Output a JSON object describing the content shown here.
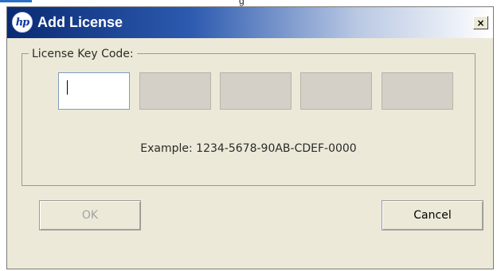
{
  "window": {
    "title": "Add License",
    "logo_text": "hp",
    "close_glyph": "×",
    "behind_fragment": "g"
  },
  "license": {
    "group_label": "License Key Code:",
    "fields": [
      {
        "value": "",
        "placeholder": ""
      },
      {
        "value": "",
        "placeholder": ""
      },
      {
        "value": "",
        "placeholder": ""
      },
      {
        "value": "",
        "placeholder": ""
      },
      {
        "value": "",
        "placeholder": ""
      }
    ],
    "example": "Example: 1234-5678-90AB-CDEF-0000"
  },
  "buttons": {
    "ok_label": "OK",
    "cancel_label": "Cancel"
  },
  "colors": {
    "titlebar_start": "#0a2a73",
    "titlebar_end": "#ffffff",
    "dialog_bg": "#ece9d8",
    "disabled_field_bg": "#d4d0c8",
    "disabled_text": "#a3a3a3"
  },
  "icons": {
    "logo": "hp-logo-icon",
    "close": "close-icon"
  }
}
